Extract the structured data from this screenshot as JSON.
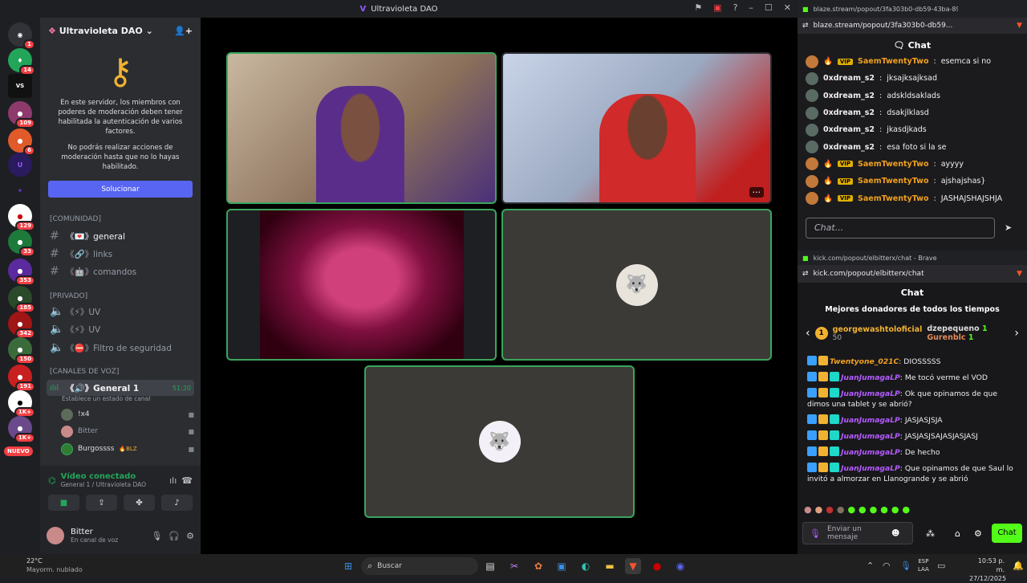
{
  "window": {
    "title": "Ultravioleta DAO"
  },
  "server": {
    "name": "Ultravioleta DAO",
    "chevron": "chevron-down-icon"
  },
  "rail_badges": [
    "1",
    "14",
    "109",
    "6",
    "129",
    "33",
    "353",
    "185",
    "342",
    "150",
    "191",
    "1K+",
    "1K+"
  ],
  "rail_labels": {
    "new": "NUEVO"
  },
  "mfa": {
    "text1": "En este servidor, los miembros con poderes de moderación deben tener habilitada la autenticación de varios factores.",
    "text2": "No podrás realizar acciones de moderación hasta que no lo hayas habilitado.",
    "button": "Solucionar"
  },
  "categories": {
    "comunidad": "[COMUNIDAD]",
    "privado": "[PRIVADO]",
    "voz": "[CANALES DE VOZ]"
  },
  "channels": [
    {
      "label": "《💌》general",
      "active": true
    },
    {
      "label": "《🔗》links",
      "active": false
    },
    {
      "label": "《🤖》comandos",
      "active": false
    }
  ],
  "private_channels": [
    {
      "label": "《⚡》UV"
    },
    {
      "label": "《⚡》UV"
    },
    {
      "label": "《⛔》Filtro de seguridad"
    }
  ],
  "voice_channel": {
    "label": "《🔊》General 1",
    "time": "51:20",
    "status": "Establece un estado de canal"
  },
  "voice_users": [
    "!x4",
    "Bitter",
    "Burgossss",
    "BLZ"
  ],
  "voice_panel": {
    "status": "Vídeo conectado",
    "location": "General 1 / Ultravioleta DAO"
  },
  "user": {
    "name": "Bitter",
    "status": "En canal de voz"
  },
  "browser1": {
    "tab": "blaze.stream/popout/3fa303b0-db59-43ba-89a...",
    "url": "blaze.stream/popout/3fa303b0-db59...",
    "chat_title": "Chat",
    "input_placeholder": "Chat...",
    "messages": [
      {
        "user": "SaemTwentyTwo",
        "text": "esemca si no",
        "vip": true
      },
      {
        "user": "0xdream_s2",
        "text": "jksajksajksad",
        "vip": false
      },
      {
        "user": "0xdream_s2",
        "text": "adskldsaklads",
        "vip": false
      },
      {
        "user": "0xdream_s2",
        "text": "dsakjlklasd",
        "vip": false
      },
      {
        "user": "0xdream_s2",
        "text": "jkasdjkads",
        "vip": false
      },
      {
        "user": "0xdream_s2",
        "text": "esa foto si la se",
        "vip": false
      },
      {
        "user": "SaemTwentyTwo",
        "text": "ayyyy",
        "vip": true
      },
      {
        "user": "SaemTwentyTwo",
        "text": "ajshajshas}",
        "vip": true
      },
      {
        "user": "SaemTwentyTwo",
        "text": "JASHAJSHAJSHJA",
        "vip": true
      }
    ],
    "vip_label": "VIP"
  },
  "browser2": {
    "tab": "kick.com/popout/elbitterx/chat - Brave",
    "url": "kick.com/popout/elbitterx/chat",
    "chat_title": "Chat",
    "donors_title": "Mejores donadores de todos los tiempos",
    "donor1": {
      "rank": "1",
      "name": "georgewashtoloficial",
      "amount": "50"
    },
    "donor2": {
      "name": "dzepequeno",
      "amount": "1"
    },
    "donor3": {
      "name": "Gurenblc",
      "amount": "1"
    },
    "messages": [
      {
        "user": "Twentyone_021C",
        "text": "DIOSSSSS",
        "color": "#f0a020"
      },
      {
        "user": "JuanJumagaLP",
        "text": "Me tocó verme el VOD",
        "color": "#b45bff"
      },
      {
        "user": "JuanJumagaLP",
        "text": "Ok que opinamos de que dimos una tablet y se abrió?",
        "color": "#b45bff"
      },
      {
        "user": "JuanJumagaLP",
        "text": "JASJASJSJA",
        "color": "#b45bff"
      },
      {
        "user": "JuanJumagaLP",
        "text": "JASJASJSAJASJASJASJ",
        "color": "#b45bff"
      },
      {
        "user": "JuanJumagaLP",
        "text": "De hecho",
        "color": "#b45bff"
      },
      {
        "user": "JuanJumagaLP",
        "text": "Que opinamos de que Saul lo invitó a almorzar en Llanogrande y se abrió",
        "color": "#b45bff"
      }
    ],
    "input_placeholder": "Enviar un mensaje",
    "chat_button": "Chat"
  },
  "taskbar": {
    "weather_temp": "22°C",
    "weather_desc": "Mayorm. nublado",
    "search": "Buscar",
    "lang1": "ESP",
    "lang2": "LAA",
    "time": "10:53 p. m.",
    "date": "27/12/2025"
  },
  "colors": {
    "accent": "#5865f2",
    "speaking": "#3ba55c",
    "kick_green": "#53fc18"
  }
}
